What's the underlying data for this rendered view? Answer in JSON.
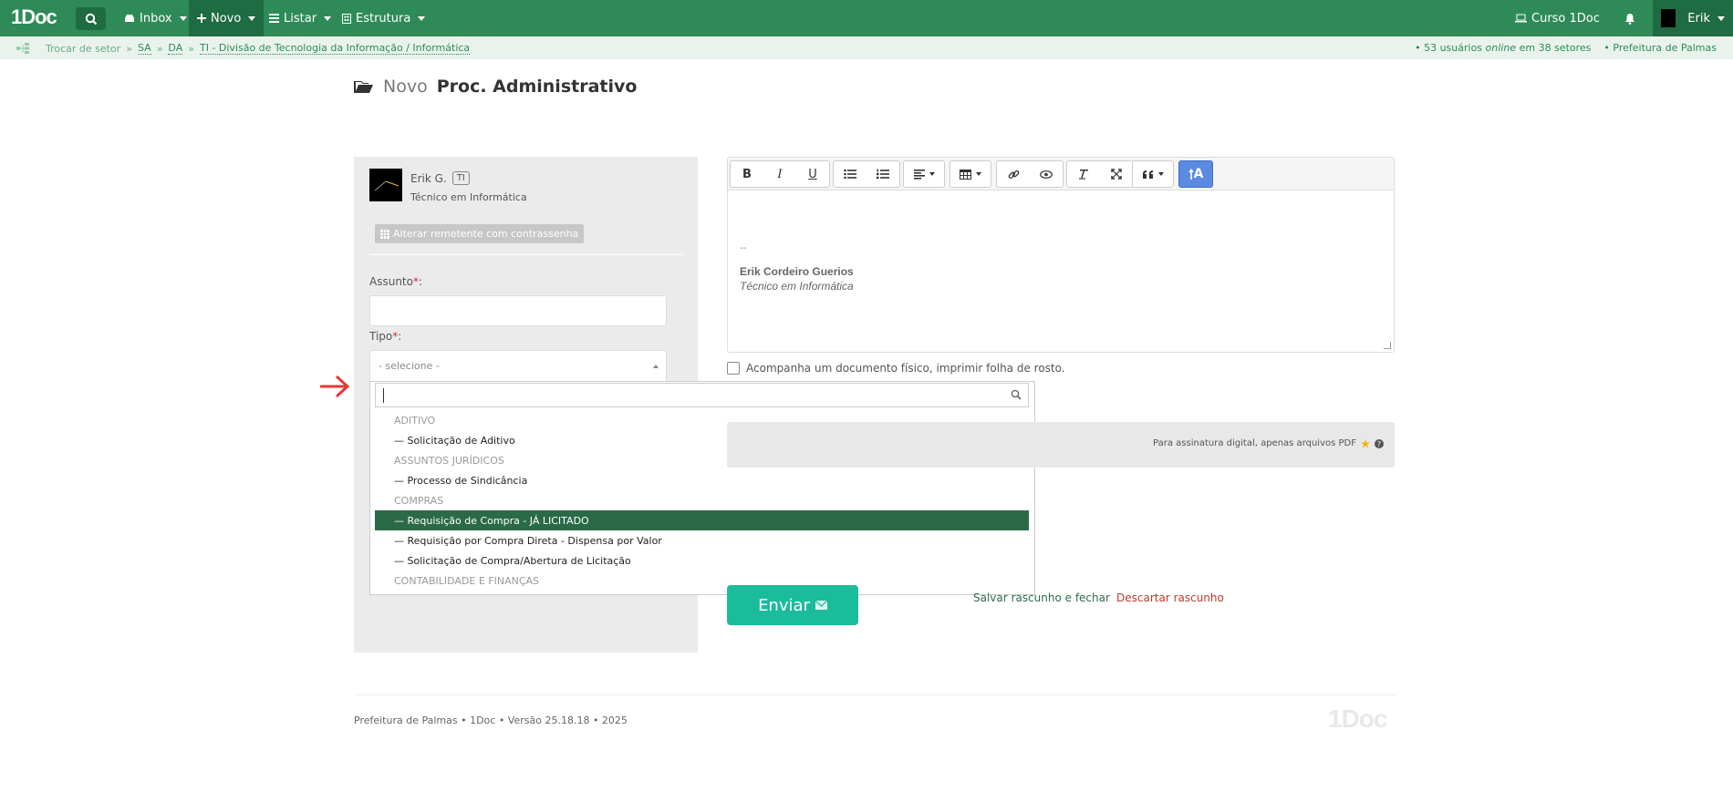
{
  "brand": {
    "logo": "1Doc"
  },
  "nav": {
    "items": [
      {
        "label": "Inbox",
        "icon": "inbox-icon"
      },
      {
        "label": "Novo",
        "icon": "plus-icon"
      },
      {
        "label": "Listar",
        "icon": "list-icon"
      },
      {
        "label": "Estrutura",
        "icon": "building-icon"
      }
    ],
    "course": "Curso 1Doc",
    "user": "Erik"
  },
  "breadcrumb": {
    "trocar": "Trocar de setor",
    "sep": "»",
    "sa": "SA",
    "da": "DA",
    "ti": "TI - Divisão de Tecnologia da Informação / Informática",
    "online_prefix": "• 53 usuários ",
    "online_word": "online",
    "online_suffix": " em 38 setores",
    "org": "• Prefeitura de Palmas"
  },
  "page": {
    "title_prefix": "Novo",
    "title_main": "Proc. Administrativo"
  },
  "sender": {
    "name": "Erik G.",
    "badge": "TI",
    "role": "Técnico em Informática",
    "alt_button": "Alterar remetente com contrassenha"
  },
  "form": {
    "assunto_label": "Assunto",
    "tipo_label": "Tipo",
    "required_mark": "*",
    "colon": ":",
    "tipo_placeholder": "- selecione -"
  },
  "dropdown": {
    "items": [
      {
        "label": "ADITIVO",
        "group": true
      },
      {
        "label": "— Solicitação de Aditivo",
        "group": false
      },
      {
        "label": "ASSUNTOS JURÍDICOS",
        "group": true
      },
      {
        "label": "— Processo de Sindicância",
        "group": false
      },
      {
        "label": "COMPRAS",
        "group": true
      },
      {
        "label": "— Requisição de Compra - JÁ LICITADO",
        "group": false,
        "selected": true
      },
      {
        "label": "— Requisição por Compra Direta - Dispensa por Valor",
        "group": false
      },
      {
        "label": "— Solicitação de Compra/Abertura de Licitação",
        "group": false
      },
      {
        "label": "CONTABILIDADE E FINANÇAS",
        "group": true
      }
    ]
  },
  "editor": {
    "signature_dash": "--",
    "signature_name": "Erik Cordeiro Guerios",
    "signature_role": "Técnico em Informática",
    "toolbar": {
      "bold": "B",
      "italic": "I",
      "underline": "U",
      "active_label": "A"
    }
  },
  "options": {
    "physical_doc": "Acompanha um documento físico, imprimir folha de rosto."
  },
  "attach": {
    "note": "Para assinatura digital, apenas arquivos PDF"
  },
  "actions": {
    "send": "Enviar",
    "save_draft": "Salvar rascunho e fechar",
    "discard": "Descartar rascunho"
  },
  "footer": {
    "text": "Prefeitura de Palmas • 1Doc • Versão 25.18.18 • 2025",
    "logo": "1Doc"
  },
  "colors": {
    "brand_green": "#2e8b57",
    "selected_green": "#2a6a47",
    "send_teal": "#1abc9c",
    "danger": "#c0392b"
  }
}
